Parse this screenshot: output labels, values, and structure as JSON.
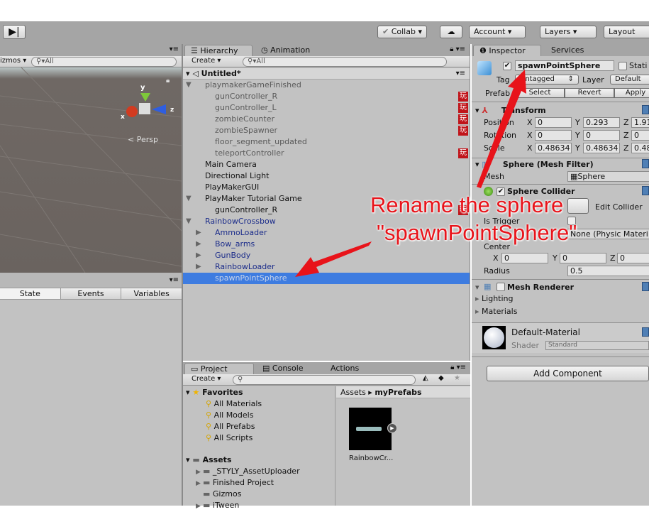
{
  "toolbar": {
    "step_icon": "step-icon",
    "collab": "Collab ▾",
    "cloud_icon": "cloud-icon",
    "account": "Account ▾",
    "layers": "Layers ▾",
    "layout": "Layout"
  },
  "scene": {
    "gizmos": "izmos ▾",
    "search_placeholder": "All",
    "axis_y": "y",
    "axis_x": "x",
    "axis_z": "z",
    "persp": "Persp",
    "tabs": [
      "State",
      "Events",
      "Variables"
    ]
  },
  "hierarchy": {
    "tab": "Hierarchy",
    "tab2": "Animation",
    "create": "Create ▾",
    "search_placeholder": "All",
    "scene_name": "Untitled*",
    "items": [
      {
        "label": "playmakerGameFinished",
        "indent": 1,
        "arrow": "down",
        "color": "grey",
        "pm": false
      },
      {
        "label": "gunController_R",
        "indent": 2,
        "color": "grey",
        "pm": true
      },
      {
        "label": "gunController_L",
        "indent": 2,
        "color": "grey",
        "pm": true
      },
      {
        "label": "zombieCounter",
        "indent": 2,
        "color": "grey",
        "pm": true
      },
      {
        "label": "zombieSpawner",
        "indent": 2,
        "color": "grey",
        "pm": true
      },
      {
        "label": "floor_segment_updated",
        "indent": 2,
        "color": "grey",
        "pm": false
      },
      {
        "label": "teleportController",
        "indent": 2,
        "color": "grey",
        "pm": true
      },
      {
        "label": "Main Camera",
        "indent": 1,
        "color": "black",
        "pm": false
      },
      {
        "label": "Directional Light",
        "indent": 1,
        "color": "black",
        "pm": false
      },
      {
        "label": "PlayMakerGUI",
        "indent": 1,
        "color": "black",
        "pm": false
      },
      {
        "label": "PlayMaker Tutorial Game",
        "indent": 1,
        "arrow": "down",
        "color": "black",
        "pm": false
      },
      {
        "label": "gunController_R",
        "indent": 2,
        "color": "black",
        "pm": true
      },
      {
        "label": "RainbowCrossbow",
        "indent": 1,
        "arrow": "down",
        "color": "blue",
        "pm": false
      },
      {
        "label": "AmmoLoader",
        "indent": 2,
        "arrow": "right",
        "color": "blue",
        "pm": false
      },
      {
        "label": "Bow_arms",
        "indent": 2,
        "arrow": "right",
        "color": "blue",
        "pm": false
      },
      {
        "label": "GunBody",
        "indent": 2,
        "arrow": "right",
        "color": "blue",
        "pm": false
      },
      {
        "label": "RainbowLoader",
        "indent": 2,
        "arrow": "right",
        "color": "blue",
        "pm": false
      },
      {
        "label": "spawnPointSphere",
        "indent": 2,
        "color": "selected",
        "pm": false
      }
    ]
  },
  "project": {
    "tabs": [
      "Project",
      "Console",
      "Actions"
    ],
    "create": "Create ▾",
    "favorites": "Favorites",
    "fav_items": [
      "All Materials",
      "All Models",
      "All Prefabs",
      "All Scripts"
    ],
    "assets": "Assets",
    "folders": [
      {
        "label": "_STYLY_AssetUploader",
        "arrow": true
      },
      {
        "label": "Finished Project",
        "arrow": true
      },
      {
        "label": "Gizmos",
        "arrow": false
      },
      {
        "label": "iTween",
        "arrow": true
      }
    ],
    "breadcrumb": [
      "Assets",
      "myPrefabs"
    ],
    "asset_name": "RainbowCr..."
  },
  "inspector": {
    "tab": "Inspector",
    "tab2": "Services",
    "name": "spawnPointSphere",
    "static": "Stati",
    "tag_label": "Tag",
    "tag_value": "Untagged",
    "layer_label": "Layer",
    "layer_value": "Default",
    "prefab_label": "Prefab",
    "select": "Select",
    "revert": "Revert",
    "apply": "Apply",
    "transform": {
      "title": "Transform",
      "rows": [
        {
          "label": "Position",
          "x": "0",
          "y": "0.293",
          "z": "1.91"
        },
        {
          "label": "Rotation",
          "x": "0",
          "y": "0",
          "z": "0"
        },
        {
          "label": "Scale",
          "x": "0.48634",
          "y": "0.48634",
          "z": "0.48"
        }
      ]
    },
    "mesh_filter": {
      "title": "Sphere (Mesh Filter)",
      "mesh_label": "Mesh",
      "mesh_value": "Sphere"
    },
    "collider": {
      "title": "Sphere Collider",
      "edit": "Edit Collider",
      "is_trigger": "Is Trigger",
      "material_value": "None (Physic Materi",
      "center": "Center",
      "cx": "0",
      "cy": "0",
      "cz": "0",
      "radius_label": "Radius",
      "radius": "0.5"
    },
    "renderer": {
      "title": "Mesh Renderer",
      "lighting": "Lighting",
      "materials": "Materials"
    },
    "material": {
      "name": "Default-Material",
      "shader_label": "Shader",
      "shader": "Standard"
    },
    "add_component": "Add Component"
  },
  "annotation": {
    "line1": "Rename the sphere",
    "line2": "\"spawnPointSphere\"",
    "color": "#e8131a"
  }
}
